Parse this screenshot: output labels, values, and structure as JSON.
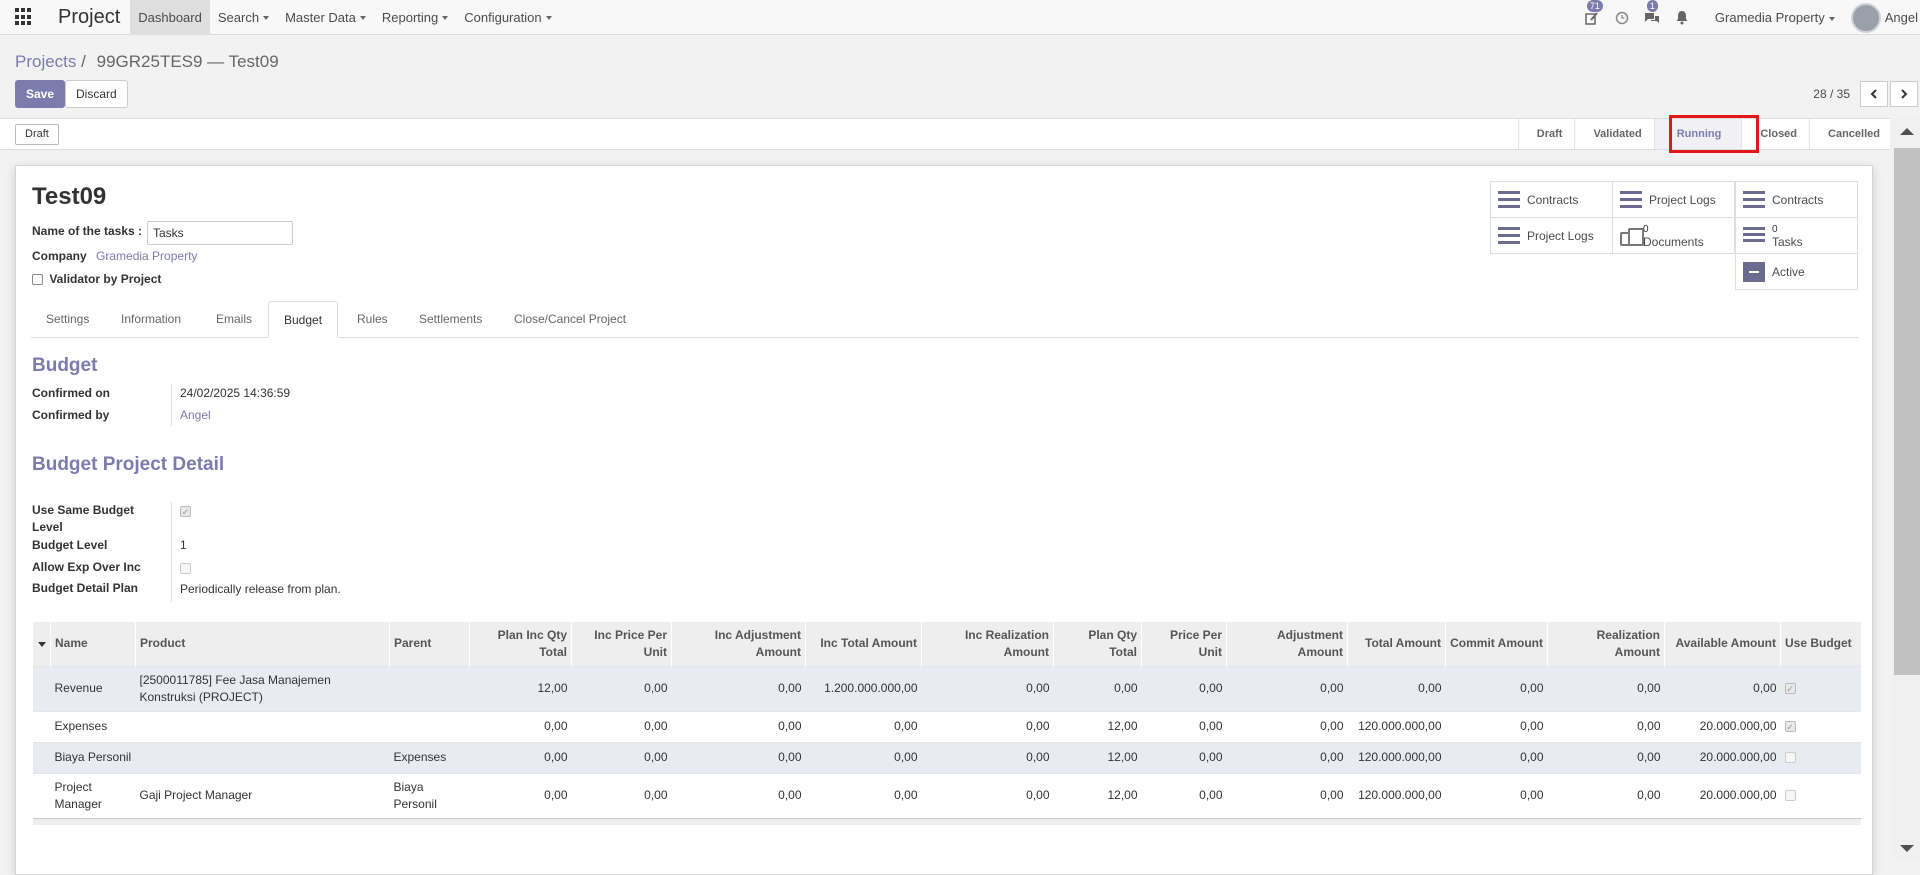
{
  "navbar": {
    "app_name": "Project",
    "menu": [
      "Dashboard",
      "Search",
      "Master Data",
      "Reporting",
      "Configuration"
    ],
    "activity_badge": "71",
    "messages_badge": "1",
    "company": "Gramedia Property",
    "user": "Angel"
  },
  "breadcrumb": {
    "parent": "Projects",
    "separator": "/",
    "current": "99GR25TES9 — Test09"
  },
  "actions": {
    "save": "Save",
    "discard": "Discard"
  },
  "pager": {
    "value": "28 / 35"
  },
  "statusbar": {
    "action_button": "Draft",
    "stages": [
      "Draft",
      "Validated",
      "Running",
      "Closed",
      "Cancelled"
    ],
    "current_stage": "Running"
  },
  "record": {
    "title": "Test09",
    "tasks_label": "Name of the tasks :",
    "tasks_value": "Tasks",
    "company_label": "Company",
    "company_value": "Gramedia Property",
    "validator_label": "Validator by Project"
  },
  "smart_buttons": {
    "contracts_1": "Contracts",
    "project_logs_1": "Project Logs",
    "contracts_2": "Contracts",
    "project_logs_2": "Project Logs",
    "documents_count": "0",
    "documents_label": "Documents",
    "tasks_count": "0",
    "tasks_label": "Tasks",
    "active_label": "Active"
  },
  "tabs": [
    "Settings",
    "Information",
    "Emails",
    "Budget",
    "Rules",
    "Settlements",
    "Close/Cancel Project"
  ],
  "active_tab": "Budget",
  "budget": {
    "title": "Budget",
    "confirmed_on_label": "Confirmed on",
    "confirmed_on_value": "24/02/2025 14:36:59",
    "confirmed_by_label": "Confirmed by",
    "confirmed_by_value": "Angel"
  },
  "budget_detail": {
    "title": "Budget Project Detail",
    "same_level_label": "Use Same Budget Level",
    "budget_level_label": "Budget Level",
    "budget_level_value": "1",
    "allow_exp_label": "Allow Exp Over Inc",
    "plan_label": "Budget Detail Plan",
    "plan_value": "Periodically release from plan."
  },
  "table": {
    "columns": [
      "Name",
      "Product",
      "Parent",
      "Plan Inc Qty Total",
      "Inc Price Per Unit",
      "Inc Adjustment Amount",
      "Inc Total Amount",
      "Inc Realization Amount",
      "Plan Qty Total",
      "Price Per Unit",
      "Adjustment Amount",
      "Total Amount",
      "Commit Amount",
      "Realization Amount",
      "Available Amount",
      "Use Budget"
    ],
    "rows": [
      [
        "Revenue",
        "[2500011785] Fee Jasa Manajemen Konstruksi (PROJECT)",
        "",
        "12,00",
        "0,00",
        "0,00",
        "1.200.000.000,00",
        "0,00",
        "0,00",
        "0,00",
        "0,00",
        "0,00",
        "0,00",
        "0,00",
        "0,00"
      ],
      [
        "Expenses",
        "",
        "",
        "0,00",
        "0,00",
        "0,00",
        "0,00",
        "0,00",
        "12,00",
        "0,00",
        "0,00",
        "120.000.000,00",
        "0,00",
        "0,00",
        "20.000.000,00"
      ],
      [
        "Biaya Personil",
        "",
        "Expenses",
        "0,00",
        "0,00",
        "0,00",
        "0,00",
        "0,00",
        "12,00",
        "0,00",
        "0,00",
        "120.000.000,00",
        "0,00",
        "0,00",
        "20.000.000,00"
      ],
      [
        "Project Manager",
        "Gaji Project Manager",
        "Biaya Personil",
        "0,00",
        "0,00",
        "0,00",
        "0,00",
        "0,00",
        "12,00",
        "0,00",
        "0,00",
        "120.000.000,00",
        "0,00",
        "0,00",
        "20.000.000,00"
      ]
    ]
  }
}
